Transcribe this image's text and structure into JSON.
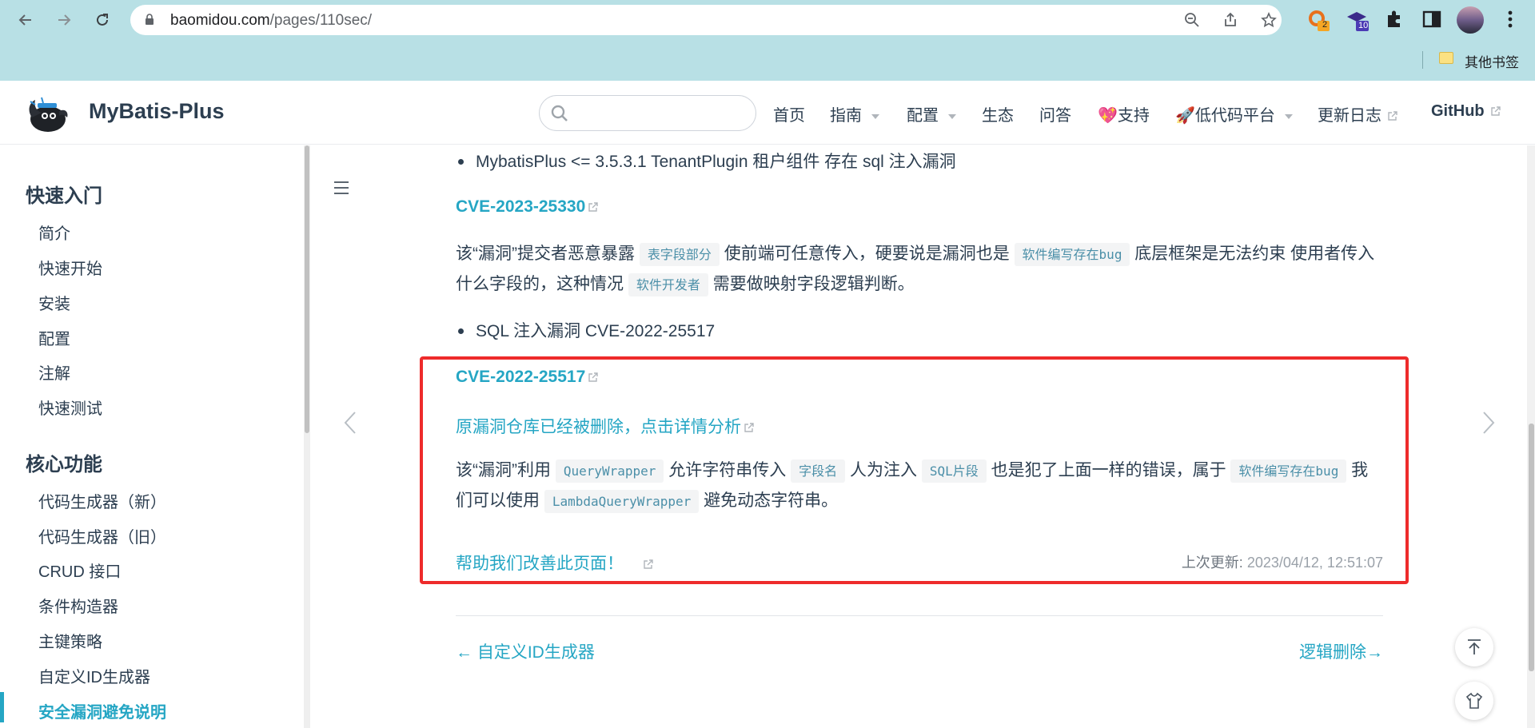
{
  "browser": {
    "url_host": "baomidou.com",
    "url_path": "/pages/110sec/",
    "bookmarks_label": "其他书签",
    "ext_badge_1": "2",
    "ext_badge_2": "10"
  },
  "header": {
    "site_title": "MyBatis-Plus",
    "search_placeholder": "",
    "nav": [
      {
        "label": "首页"
      },
      {
        "label": "指南"
      },
      {
        "label": "配置"
      },
      {
        "label": "生态"
      },
      {
        "label": "问答"
      },
      {
        "label": "💖支持"
      },
      {
        "label": "🚀低代码平台"
      },
      {
        "label": "更新日志"
      },
      {
        "label": "GitHub"
      }
    ]
  },
  "sidebar": {
    "groups": [
      {
        "title": "快速入门",
        "items": [
          "简介",
          "快速开始",
          "安装",
          "配置",
          "注解",
          "快速测试"
        ]
      },
      {
        "title": "核心功能",
        "items": [
          "代码生成器（新）",
          "代码生成器（旧）",
          "CRUD 接口",
          "条件构造器",
          "主键策略",
          "自定义ID生成器",
          "安全漏洞避免说明"
        ]
      }
    ]
  },
  "content": {
    "bullet1": "MybatisPlus <= 3.5.3.1 TenantPlugin 租户组件 存在 sql 注入漏洞",
    "cve1_link": "CVE-2023-25330",
    "p1_a": "该“漏洞”提交者恶意暴露",
    "p1_code1": "表字段部分",
    "p1_b": "使前端可任意传入，硬要说是漏洞也是",
    "p1_code2": "软件编写存在bug",
    "p1_c": "底层框架是无法约束 使用者传入什么字段的，这种情况",
    "p1_code3": "软件开发者",
    "p1_d": "需要做映射字段逻辑判断。",
    "bullet2": "SQL 注入漏洞 CVE-2022-25517",
    "cve2_link": "CVE-2022-25517",
    "repo_link": "原漏洞仓库已经被删除，点击详情分析",
    "p2_a": "该“漏洞”利用",
    "p2_code1": "QueryWrapper",
    "p2_b": "允许字符串传入",
    "p2_code2": "字段名",
    "p2_c": "人为注入",
    "p2_code3": "SQL片段",
    "p2_d": "也是犯了上面一样的错误，属于",
    "p2_code4": "软件编写存在bug",
    "p2_e": "我们可以使用",
    "p2_code5": "LambdaQueryWrapper",
    "p2_f": "避免动态字符串。",
    "help_link": "帮助我们改善此页面！",
    "last_updated_label": "上次更新:",
    "last_updated_value": "2023/04/12, 12:51:07",
    "prev_link": "← 自定义ID生成器",
    "next_link": "逻辑删除→"
  },
  "colors": {
    "accent": "#25a6c4",
    "highlight_box": "#ee2b2b",
    "chrome_bg": "#b8e0e5"
  }
}
